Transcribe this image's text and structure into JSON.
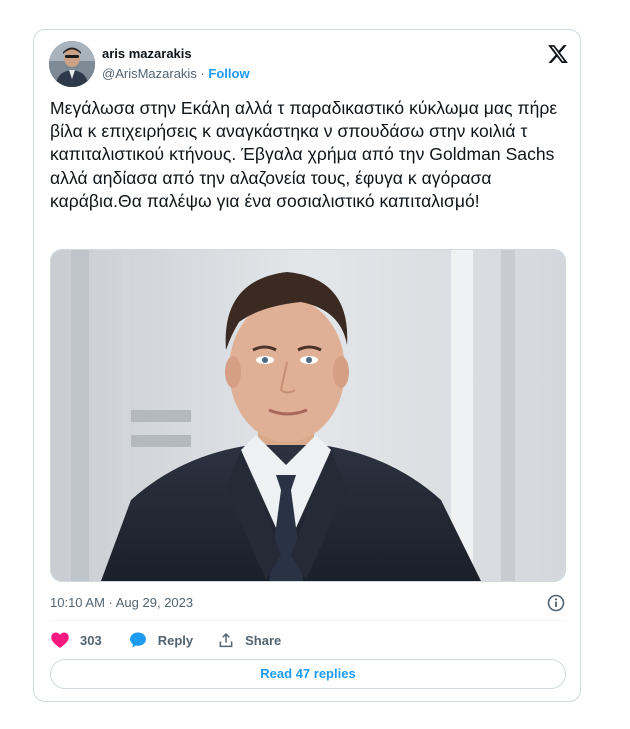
{
  "author": {
    "display_name": "aris mazarakis",
    "handle": "@ArisMazarakis",
    "separator": "·",
    "follow_label": "Follow",
    "avatar_icon": "profile-photo"
  },
  "tweet": {
    "text": "Μεγάλωσα στην Εκάλη αλλά τ παραδικαστικό κύκλωμα μας πήρε βίλα κ επιχειρήσεις κ αναγκάστηκα ν σπουδάσω στην κοιλιά τ καπιταλιστικού κτήνους. Έβγαλα χρήμα από την Goldman Sachs αλλά αηδίασα από την αλαζονεία τους, έφυγα κ αγόρασα καράβια.Θα παλέψω για ένα σοσιαλιστικό καπιταλισμό!",
    "timestamp": "10:10 AM · Aug 29, 2023",
    "media_icon": "portrait-photo-man-in-suit"
  },
  "actions": {
    "like_count": "303",
    "reply_label": "Reply",
    "share_label": "Share"
  },
  "footer": {
    "read_replies_label": "Read 47 replies"
  },
  "colors": {
    "accent": "#1d9bf0",
    "like": "#f91880",
    "text": "#0f1419",
    "muted": "#536471",
    "border": "#cfd9de"
  }
}
